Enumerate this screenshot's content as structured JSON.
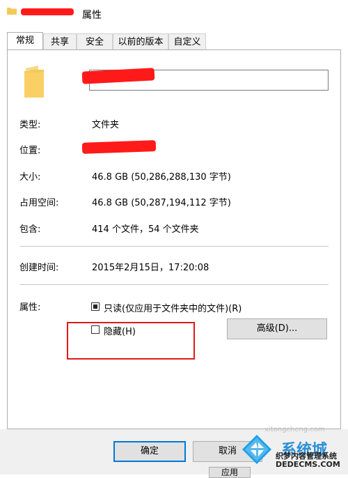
{
  "window": {
    "title_suffix": "属性"
  },
  "tabs": [
    {
      "label": "常规"
    },
    {
      "label": "共享"
    },
    {
      "label": "安全"
    },
    {
      "label": "以前的版本"
    },
    {
      "label": "自定义"
    }
  ],
  "general": {
    "name_value": "",
    "rows": [
      {
        "label": "类型:",
        "value": "文件夹"
      },
      {
        "label": "位置:",
        "value": ""
      },
      {
        "label": "大小:",
        "value": "46.8 GB (50,286,288,130 字节)"
      },
      {
        "label": "占用空间:",
        "value": "46.8 GB (50,287,194,112 字节)"
      },
      {
        "label": "包含:",
        "value": "414 个文件，54 个文件夹"
      },
      {
        "label": "创建时间:",
        "value": "2015年2月15日，17:20:08"
      }
    ],
    "attributes_label": "属性:",
    "readonly_label": "只读(仅应用于文件夹中的文件)(R)",
    "readonly_state": "indeterminate",
    "hidden_label": "隐藏(H)",
    "hidden_state": "unchecked",
    "advanced_button": "高级(D)..."
  },
  "buttons": {
    "ok": "确定",
    "cancel": "取消",
    "apply": "应用"
  },
  "watermark": {
    "line1": "织梦内容管理系统",
    "line2": "DEDECMS.COM",
    "line3": "xitongcheng.com",
    "brand": "系统城"
  },
  "colors": {
    "accent": "#0078d7",
    "highlight": "#e01818",
    "redaction": "#ff1a1a",
    "folder": "#f3c95a"
  }
}
